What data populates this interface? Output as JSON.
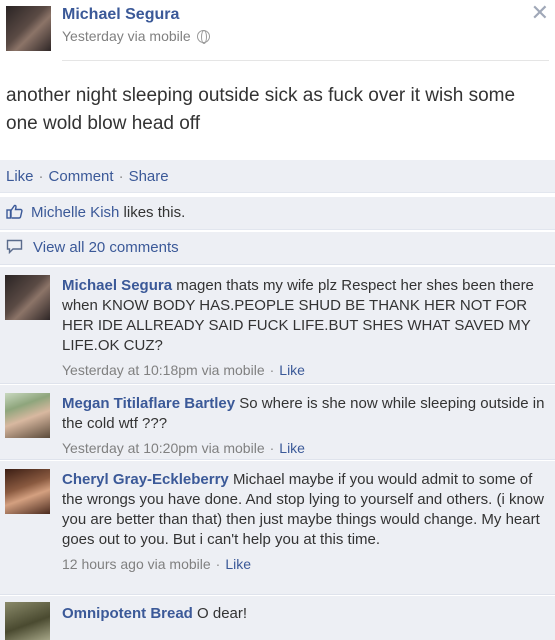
{
  "post": {
    "author": "Michael Segura",
    "meta": "Yesterday via mobile",
    "text": "another night sleeping outside sick as fuck over it wish some one wold blow head off"
  },
  "actions": {
    "like": "Like",
    "comment": "Comment",
    "share": "Share",
    "separator": "·"
  },
  "likes": {
    "name": "Michelle Kish",
    "suffix": "likes this."
  },
  "view_all": "View all 20 comments",
  "comments": [
    {
      "author": "Michael Segura",
      "text": "magen thats my wife plz Respect her shes been there when KNOW BODY HAS.PEOPLE SHUD BE THANK HER NOT FOR HER IDE ALLREADY SAID FUCK LIFE.BUT SHES WHAT SAVED MY LIFE.OK CUZ?",
      "time": "Yesterday at 10:18pm via mobile",
      "like": "Like"
    },
    {
      "author": "Megan Titilaflare Bartley",
      "text": "So where is she now while sleeping outside in the cold wtf ???",
      "time": "Yesterday at 10:20pm via mobile",
      "like": "Like"
    },
    {
      "author": "Cheryl Gray-Eckleberry",
      "text": "Michael maybe if you would admit to some of the wrongs you have done. And stop lying to yourself and others. (i know you are better than that) then just maybe things would change. My heart goes out to you. But i can't help you at this time.",
      "time": "12 hours ago via mobile",
      "like": "Like"
    },
    {
      "author": "Omnipotent Bread",
      "text": "O dear!",
      "time": "",
      "like": ""
    }
  ],
  "colors": {
    "link": "#3b5998",
    "panel": "#edeff4",
    "meta": "#808080"
  },
  "icons": [
    "globe-icon",
    "close-icon",
    "thumbs-up-icon",
    "comment-bubble-icon"
  ]
}
